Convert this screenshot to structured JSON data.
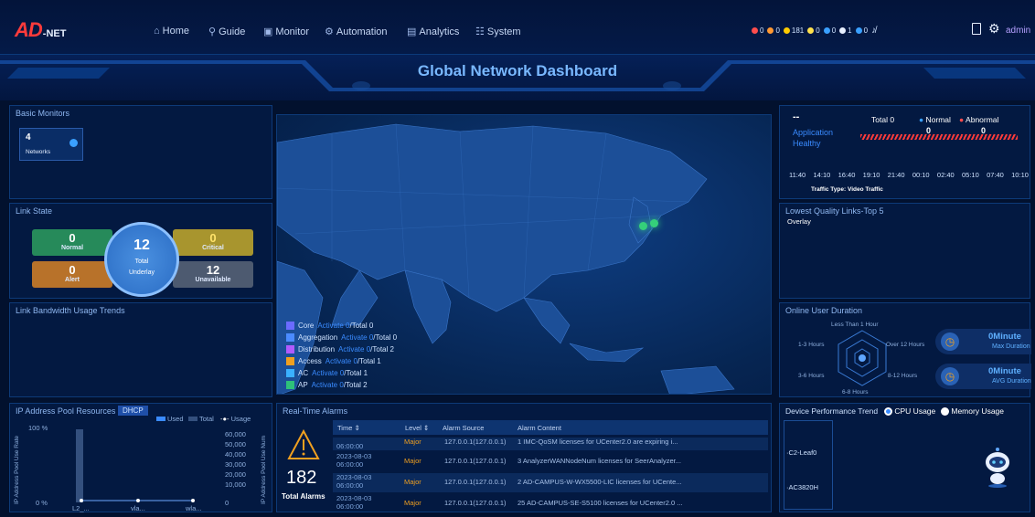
{
  "app": {
    "logo": "AD",
    "logo_suffix": "-NET",
    "admin": "admin"
  },
  "nav": [
    {
      "icon": "⌂",
      "label": "Home"
    },
    {
      "icon": "⚲",
      "label": "Guide"
    },
    {
      "icon": "▣",
      "label": "Monitor"
    },
    {
      "icon": "⚙",
      "label": "Automation"
    },
    {
      "icon": "▤",
      "label": "Analytics"
    },
    {
      "icon": "☷",
      "label": "System"
    }
  ],
  "badges": [
    {
      "color": "#ff4d4d",
      "count": "0"
    },
    {
      "color": "#ff9933",
      "count": "0"
    },
    {
      "color": "#ffcc00",
      "count": "181"
    },
    {
      "color": "#ffe14d",
      "count": "0"
    },
    {
      "color": "#3aa0ff",
      "count": "0"
    },
    {
      "color": "#e8f0ff",
      "count": "1"
    },
    {
      "color": "#3aa0ff",
      "count": "0"
    }
  ],
  "title": "Global Network Dashboard",
  "basic_monitors": {
    "title": "Basic Monitors",
    "count": "4",
    "label": "Networks"
  },
  "link_state": {
    "title": "Link State",
    "normal": {
      "value": "0",
      "label": "Normal"
    },
    "critical": {
      "value": "0",
      "label": "Critical"
    },
    "alert": {
      "value": "0",
      "label": "Alert"
    },
    "unavailable": {
      "value": "12",
      "label": "Unavailable"
    },
    "total": {
      "value": "12",
      "label1": "Total",
      "label2": "Underlay"
    }
  },
  "bandwidth": {
    "title": "Link Bandwidth Usage Trends"
  },
  "ip_pool": {
    "title": "IP Address Pool Resources",
    "tab": "DHCP",
    "legend": [
      "Used",
      "Total",
      "Usage"
    ],
    "y_left": [
      "100 %",
      "0 %"
    ],
    "y_left_label": "IP Address Pool Use Rate",
    "y_right": [
      "60,000",
      "50,000",
      "40,000",
      "30,000",
      "20,000",
      "10,000",
      "0"
    ],
    "y_right_label": "IP Address Pool Use Num",
    "x_labels": [
      "L2_...",
      "vla...",
      "wla..."
    ]
  },
  "map_legend": [
    {
      "color": "#6b6bff",
      "name": "Core",
      "activate": "Activate 0",
      "total": "/Total 0"
    },
    {
      "color": "#4b8bff",
      "name": "Aggregation",
      "activate": "Activate 0",
      "total": "/Total 0"
    },
    {
      "color": "#b05bff",
      "name": "Distribution",
      "activate": "Activate 0",
      "total": "/Total 2"
    },
    {
      "color": "#f0a020",
      "name": "Access",
      "activate": "Activate 0",
      "total": "/Total 1"
    },
    {
      "color": "#3ab0ff",
      "name": "AC",
      "activate": "Activate 0",
      "total": "/Total 1"
    },
    {
      "color": "#2ec07a",
      "name": "AP",
      "activate": "Activate 0",
      "total": "/Total 2"
    }
  ],
  "alarms": {
    "title": "Real-Time Alarms",
    "total": "182",
    "total_label": "Total Alarms",
    "columns": [
      "Time ⇕",
      "Level ⇕",
      "Alarm Source",
      "Alarm Content"
    ],
    "rows": [
      {
        "time": "06:00:00",
        "level": "Major",
        "source": "127.0.0.1(127.0.0.1)",
        "content": "1 IMC-QoSM licenses for UCenter2.0 are expiring i..."
      },
      {
        "time": "2023-08-03 06:00:00",
        "level": "Major",
        "source": "127.0.0.1(127.0.0.1)",
        "content": "3 AnalyzerWANNodeNum licenses for SeerAnalyzer..."
      },
      {
        "time": "2023-08-03 06:00:00",
        "level": "Major",
        "source": "127.0.0.1(127.0.0.1)",
        "content": "2 AD-CAMPUS-W-WX5500-LIC licenses for UCente..."
      },
      {
        "time": "2023-08-03 06:00:00",
        "level": "Major",
        "source": "127.0.0.1(127.0.0.1)",
        "content": "25 AD-CAMPUS-SE-S5100 licenses for UCenter2.0 ..."
      }
    ]
  },
  "app_health": {
    "title_top": "--",
    "title1": "Application",
    "title2": "Healthy",
    "total": "Total 0",
    "normal_label": "Normal",
    "normal_value": "0",
    "abnormal_label": "Abnormal",
    "abnormal_value": "0",
    "times": [
      "11:40",
      "14:10",
      "16:40",
      "19:10",
      "21:40",
      "00:10",
      "02:40",
      "05:10",
      "07:40",
      "10:10"
    ],
    "traffic": "Traffic Type:  Video Traffic"
  },
  "lowest_links": {
    "title": "Lowest Quality Links-Top 5",
    "sub": "Overlay"
  },
  "online_duration": {
    "title": "Online User Duration",
    "labels": [
      "Less Than 1 Hour",
      "1-3 Hours",
      "Over 12 Hours",
      "3-6 Hours",
      "8-12 Hours",
      "6-8 Hours"
    ],
    "max_value": "0Minute",
    "max_label": "Max Duration",
    "avg_value": "0Minute",
    "avg_label": "AVG Duration"
  },
  "device_perf": {
    "title": "Device Performance Trend",
    "cpu": "CPU Usage",
    "memory": "Memory Usage",
    "devices": [
      "C2-Leaf0",
      "AC3820H"
    ]
  }
}
